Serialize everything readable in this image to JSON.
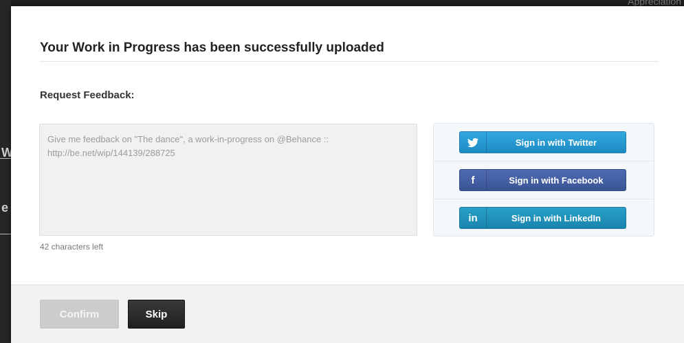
{
  "backdrop": {
    "right_text": "Appreciation",
    "left_chars": [
      "W",
      "e"
    ]
  },
  "modal": {
    "title": "Your Work in Progress has been successfully uploaded",
    "section_label": "Request Feedback:",
    "feedback": {
      "value": "Give me feedback on \"The dance\", a work-in-progress on @Behance :: http://be.net/wip/144139/288725",
      "counter": "42 characters left"
    },
    "social": [
      {
        "icon": "twitter-icon",
        "glyph": "»",
        "label": "Sign in with Twitter",
        "color": "#2a9fd8"
      },
      {
        "icon": "facebook-icon",
        "glyph": "f",
        "label": "Sign in with Facebook",
        "color": "#3b5998"
      },
      {
        "icon": "linkedin-icon",
        "glyph": "in",
        "label": "Sign in with LinkedIn",
        "color": "#1b92be"
      }
    ]
  },
  "footer": {
    "confirm_label": "Confirm",
    "skip_label": "Skip"
  }
}
